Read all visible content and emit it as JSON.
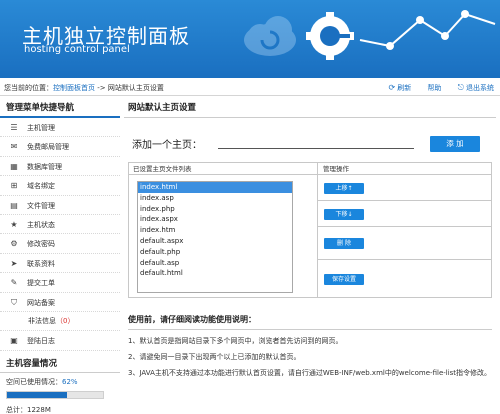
{
  "banner": {
    "title": "主机独立控制面板",
    "subtitle": "hosting control panel"
  },
  "location": {
    "prefix": "您当前的位置：",
    "home_link": "控制面板首页",
    "separator": " -> ",
    "current": "网站默认主页设置",
    "actions": [
      {
        "icon": "refresh-icon",
        "label": "刷新"
      },
      {
        "icon": "help-icon",
        "label": "帮助"
      },
      {
        "icon": "logout-icon",
        "label": "退出系统"
      }
    ]
  },
  "sidebar": {
    "title": "管理菜单快捷导航",
    "items": [
      {
        "icon": "database-icon",
        "glyph": "☰",
        "label": "主机管理"
      },
      {
        "icon": "mail-icon",
        "glyph": "✉",
        "label": "免费邮局管理"
      },
      {
        "icon": "grid-icon",
        "glyph": "▦",
        "label": "数据库管理"
      },
      {
        "icon": "plus-square-icon",
        "glyph": "⊞",
        "label": "域名绑定"
      },
      {
        "icon": "file-icon",
        "glyph": "▤",
        "label": "文件管理"
      },
      {
        "icon": "star-icon",
        "glyph": "★",
        "label": "主机状态"
      },
      {
        "icon": "gear-icon",
        "glyph": "⚙",
        "label": "修改密码"
      },
      {
        "icon": "send-icon",
        "glyph": "➤",
        "label": "联系资料"
      },
      {
        "icon": "edit-icon",
        "glyph": "✎",
        "label": "提交工单"
      },
      {
        "icon": "shield-icon",
        "glyph": "⛉",
        "label": "网站备案"
      }
    ],
    "illegal_label": "非法信息",
    "illegal_count": "（0）",
    "login_log": {
      "icon": "calendar-icon",
      "glyph": "▣",
      "label": "登陆日志"
    }
  },
  "capacity": {
    "title": "主机容量情况",
    "used_label": "空间已使用情况：",
    "used_percent": "62%",
    "used_fraction": 0.62,
    "total": "总计：1228M"
  },
  "main": {
    "title": "网站默认主页设置",
    "add_label": "添加一个主页：",
    "add_value": "",
    "add_button": "添 加",
    "list_header": "已设置主页文件列表",
    "ops_header": "管理操作",
    "files": [
      "index.html",
      "index.asp",
      "index.php",
      "index.aspx",
      "index.htm",
      "default.aspx",
      "default.php",
      "default.asp",
      "default.html"
    ],
    "selected_index": 0,
    "buttons": {
      "up": "上移↑",
      "down": "下移↓",
      "delete": "删 除",
      "save": "保存设置"
    }
  },
  "usage": {
    "title": "使用前，请仔细阅读功能使用说明：",
    "items": [
      "1、默认首页是指网站目录下多个网页中，浏览者首先访问到的网页。",
      "2、请避免同一目录下出现两个以上已添加的默认首页。",
      "3、JAVA主机不支持通过本功能进行默认首页设置，请自行通过WEB-INF/web.xml中的welcome-file-list指令修改。"
    ]
  },
  "colors": {
    "brand": "#1a6fc0",
    "button": "#1a86dd",
    "warning": "#d9302c"
  }
}
